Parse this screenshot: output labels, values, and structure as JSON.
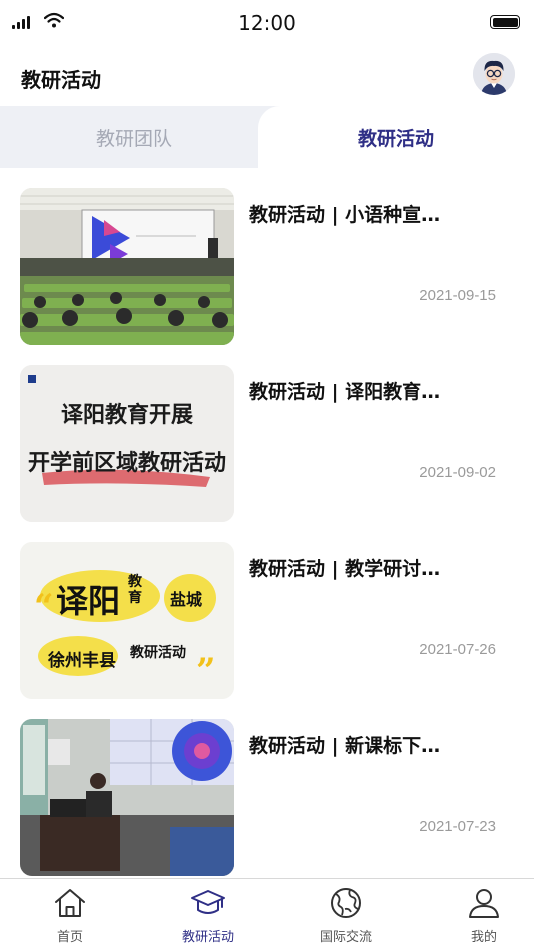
{
  "status_bar": {
    "time": "12:00"
  },
  "header": {
    "title": "教研活动",
    "avatar_icon": "user-avatar"
  },
  "tabs": [
    {
      "label": "教研团队",
      "active": false
    },
    {
      "label": "教研活动",
      "active": true
    }
  ],
  "activities": [
    {
      "title": "教研活动 | 小语种宣…",
      "date": "2021-09-15"
    },
    {
      "title": "教研活动 | 译阳教育…",
      "date": "2021-09-02",
      "thumb_text": [
        "译阳教育开展",
        "开学前区域教研活动"
      ]
    },
    {
      "title": "教研活动 | 教学研讨…",
      "date": "2021-07-26",
      "thumb_text": [
        "译阳",
        "教育",
        "盐城",
        "徐州丰县",
        "教研活动"
      ]
    },
    {
      "title": "教研活动 | 新课标下…",
      "date": "2021-07-23"
    }
  ],
  "bottom_nav": [
    {
      "label": "首页",
      "icon": "home-icon",
      "active": false
    },
    {
      "label": "教研活动",
      "icon": "graduation-cap-icon",
      "active": true
    },
    {
      "label": "国际交流",
      "icon": "globe-icon",
      "active": false
    },
    {
      "label": "我的",
      "icon": "user-icon",
      "active": false
    }
  ],
  "colors": {
    "accent": "#2f2f86",
    "tab_bg": "#eef0f5",
    "muted": "#9a9a9a"
  }
}
